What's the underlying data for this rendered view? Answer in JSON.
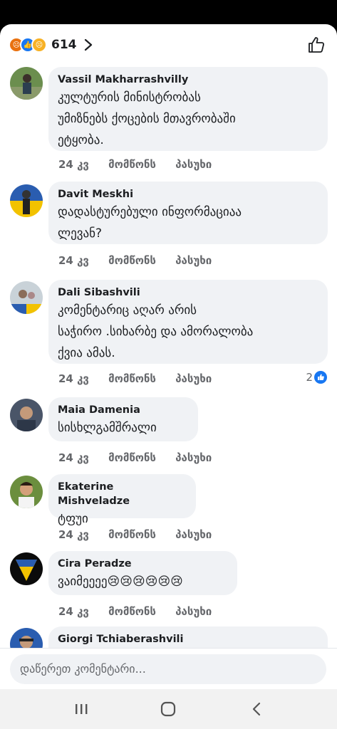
{
  "header": {
    "reaction_count": "614",
    "reactions": [
      "angry",
      "like",
      "sad"
    ]
  },
  "comments": [
    {
      "name": "Vassil Makharrashvilly",
      "lines": [
        "კულტურის მინისტრობას",
        "უმიზნებს ქოცების მთავრობაში",
        "ეტყობა."
      ],
      "time": "24 კვ",
      "like": "მომწონს",
      "reply": "პასუხი"
    },
    {
      "name": "Davit Meskhi",
      "lines": [
        "დადასტურებული ინფორმაციაა",
        "ლევან?"
      ],
      "time": "24 კვ",
      "like": "მომწონს",
      "reply": "პასუხი"
    },
    {
      "name": "Dali Sibashvili",
      "lines": [
        "კომენტარიც აღარ არის",
        "საჭირო .სიხარბე და ამორალობა",
        "ქვია ამას."
      ],
      "time": "24 კვ",
      "like": "მომწონს",
      "reply": "პასუხი",
      "reactions": "2"
    },
    {
      "name": "Maia Damenia",
      "lines": [
        "სისხლგამშრალი"
      ],
      "time": "24 კვ",
      "like": "მომწონს",
      "reply": "პასუხი"
    },
    {
      "name": "Ekaterine Mishveladze",
      "lines": [
        "ტფუი"
      ],
      "time": "24 კვ",
      "like": "მომწონს",
      "reply": "პასუხი"
    },
    {
      "name": "Cira Peradze",
      "lines": [
        "ვაიმეეეე😢😢😢😢😢😢"
      ],
      "time": "24 კვ",
      "like": "მომწონს",
      "reply": "პასუხი"
    },
    {
      "name": "Giorgi Tchiaberashvili",
      "lines": [],
      "time": "",
      "like": "",
      "reply": ""
    }
  ],
  "input": {
    "placeholder": "დაწერეთ კომენტარი..."
  },
  "colors": {
    "like_blue": "#1877f2",
    "bubble": "#f0f2f5",
    "meta_gray": "#65676b"
  },
  "icons": [
    "chevron-right-icon",
    "thumbs-up-icon",
    "recents-icon",
    "home-icon",
    "back-icon"
  ]
}
